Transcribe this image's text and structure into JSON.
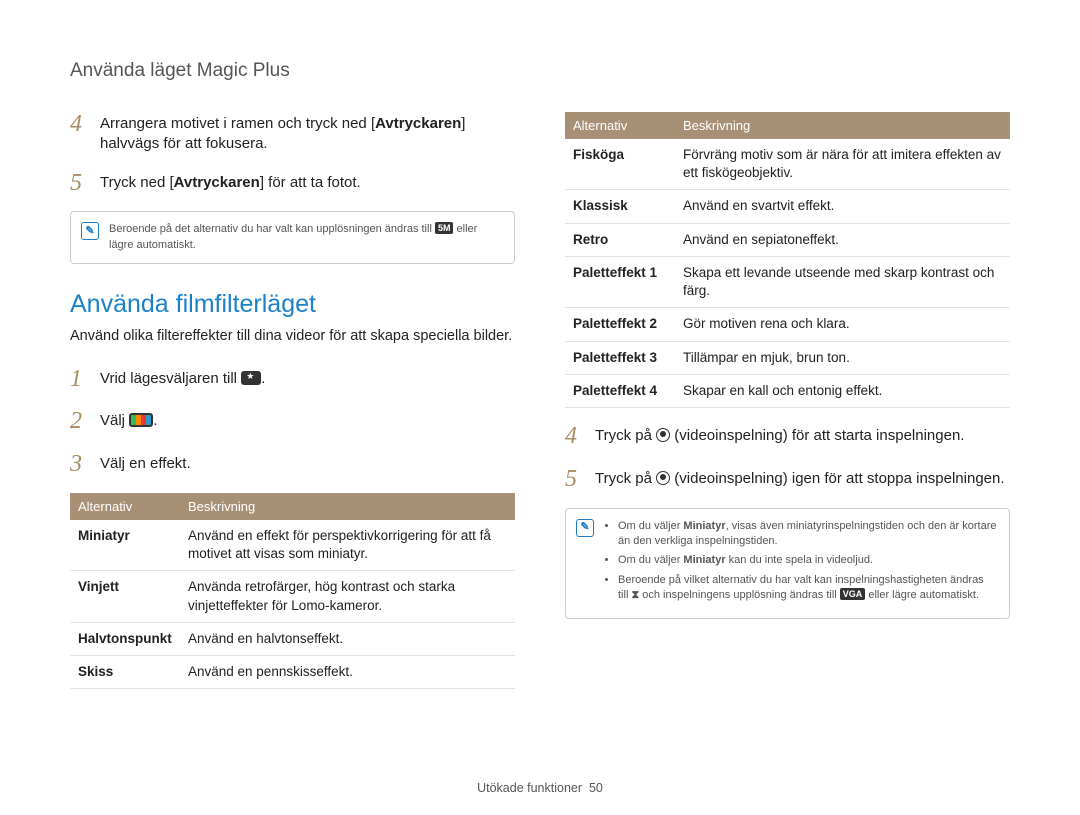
{
  "breadcrumb": "Använda läget Magic Plus",
  "left": {
    "step4": {
      "num": "4",
      "pre": "Arrangera motivet i ramen och tryck ned [",
      "bold": "Avtryckaren",
      "post": "] halvvägs för att fokusera."
    },
    "step5": {
      "num": "5",
      "pre": "Tryck ned [",
      "bold": "Avtryckaren",
      "post": "] för att ta fotot."
    },
    "note1_a": "Beroende på det alternativ du har valt kan upplösningen ändras till ",
    "note1_res": "5M",
    "note1_b": " eller lägre automatiskt.",
    "heading": "Använda filmfilterläget",
    "intro": "Använd olika filtereffekter till dina videor för att skapa speciella bilder.",
    "s1": {
      "num": "1",
      "pre": "Vrid lägesväljaren till ",
      "post": "."
    },
    "s2": {
      "num": "2",
      "pre": "Välj ",
      "post": "."
    },
    "s3": {
      "num": "3",
      "text": "Välj en effekt."
    },
    "table": {
      "h1": "Alternativ",
      "h2": "Beskrivning",
      "rows": [
        {
          "a": "Miniatyr",
          "b": "Använd en effekt för perspektivkorrigering för att få motivet att visas som miniatyr."
        },
        {
          "a": "Vinjett",
          "b": "Använda retrofärger, hög kontrast och starka vinjetteffekter för Lomo-kameror."
        },
        {
          "a": "Halvtonspunkt",
          "b": "Använd en halvtonseffekt."
        },
        {
          "a": "Skiss",
          "b": "Använd en pennskisseffekt."
        }
      ]
    }
  },
  "right": {
    "table": {
      "h1": "Alternativ",
      "h2": "Beskrivning",
      "rows": [
        {
          "a": "Fisköga",
          "b": "Förvräng motiv som är nära för att imitera effekten av ett fiskögeobjektiv."
        },
        {
          "a": "Klassisk",
          "b": "Använd en svartvit effekt."
        },
        {
          "a": "Retro",
          "b": "Använd en sepiatoneffekt."
        },
        {
          "a": "Paletteffekt 1",
          "b": "Skapa ett levande utseende med skarp kontrast och färg."
        },
        {
          "a": "Paletteffekt 2",
          "b": "Gör motiven rena och klara."
        },
        {
          "a": "Paletteffekt 3",
          "b": "Tillämpar en mjuk, brun ton."
        },
        {
          "a": "Paletteffekt 4",
          "b": "Skapar en kall och entonig effekt."
        }
      ]
    },
    "s4": {
      "num": "4",
      "pre": "Tryck på ",
      "post": " (videoinspelning) för att starta inspelningen."
    },
    "s5": {
      "num": "5",
      "pre": "Tryck på ",
      "post": " (videoinspelning) igen för att stoppa inspelningen."
    },
    "note": {
      "b1a": "Om du väljer ",
      "b1bold": "Miniatyr",
      "b1b": ", visas även miniatyrinspelningstiden och den är kortare än den verkliga inspelningstiden.",
      "b2a": "Om du väljer ",
      "b2bold": "Miniatyr",
      "b2b": " kan du inte spela in videoljud.",
      "b3a": "Beroende på vilket alternativ du har valt kan inspelningshastigheten ändras till ",
      "b3icon": "⧗",
      "b3b": " och inspelningens upplösning ändras till ",
      "b3res": "VGA",
      "b3c": " eller lägre automatiskt."
    }
  },
  "footer": {
    "label": "Utökade funktioner",
    "page": "50"
  }
}
